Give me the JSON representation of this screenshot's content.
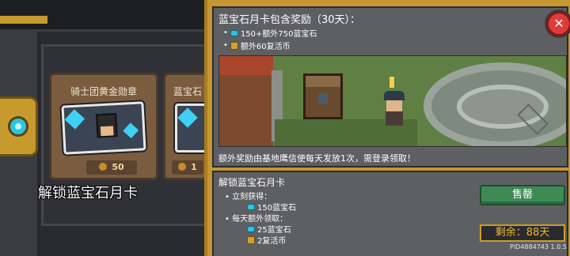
{
  "shop": {
    "cards": [
      {
        "title": "骑士团黄金勋章",
        "price": "50"
      },
      {
        "title": "蓝宝石",
        "price": "1"
      }
    ],
    "caption": "解锁蓝宝石月卡"
  },
  "rewards": {
    "title": "蓝宝石月卡包含奖励（30天）：",
    "items": [
      {
        "bullet": "•",
        "icon": "gem-icon",
        "text": "150+额外750蓝宝石"
      },
      {
        "bullet": "•",
        "icon": "revive-coin-icon",
        "text": "额外60复活币"
      }
    ],
    "note": "额外奖励由基地鹰信使每天发放1次，需登录领取！"
  },
  "unlock": {
    "title": "解锁蓝宝石月卡",
    "immediate_label": "• 立刻获得：",
    "immediate_items": [
      {
        "icon": "gem-icon",
        "text": "150蓝宝石"
      }
    ],
    "daily_label": "• 每天额外领取：",
    "daily_items": [
      {
        "icon": "gem-icon",
        "text": "25蓝宝石"
      },
      {
        "icon": "revive-coin-icon",
        "text": "2复活币"
      }
    ]
  },
  "actions": {
    "buy_label": "售罄",
    "remaining": "剩余：88天",
    "close_glyph": "✕"
  },
  "footer": {
    "version": "PID4884743 1.0.5"
  },
  "colors": {
    "panel_gold": "#c69632",
    "panel_gray": "#5e5f62",
    "buy_green": "#3e8a55",
    "close_red": "#df3b3b",
    "remaining_orange": "#f2b731"
  }
}
